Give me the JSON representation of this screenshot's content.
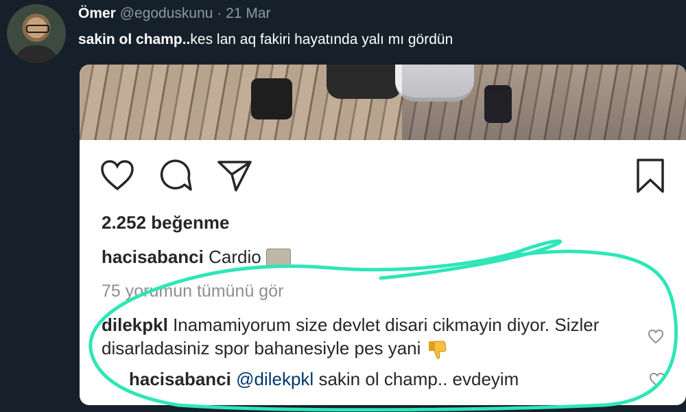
{
  "tweet": {
    "display_name": "Ömer",
    "handle": "@egoduskunu",
    "separator": "·",
    "date": "21 Mar",
    "text_bold": "sakin ol champ..",
    "text_rest": "kes lan aq fakiri hayatında yalı mı gördün"
  },
  "post": {
    "likes": "2.252 beğenme",
    "caption_user": "hacisabanci",
    "caption_text": "Cardio",
    "view_all": "75 yorumun tümünü gör",
    "comment": {
      "user": "dilekpkl",
      "text": "Inamamiyorum size devlet disari cikmayin diyor. Sizler disarladasiniz spor bahanesiyle pes yani"
    },
    "reply": {
      "user": "hacisabanci",
      "mention": "@dilekpkl",
      "text": "sakin ol champ.. evdeyim"
    }
  },
  "icons": [
    "avatar",
    "heart-icon",
    "comment-icon",
    "share-icon",
    "bookmark-icon",
    "bike-emoji-icon",
    "thumbs-down-icon",
    "small-heart-icon"
  ],
  "colors": {
    "background": "#15202b",
    "scribble": "#2ee6b8",
    "mention": "#00376b"
  }
}
